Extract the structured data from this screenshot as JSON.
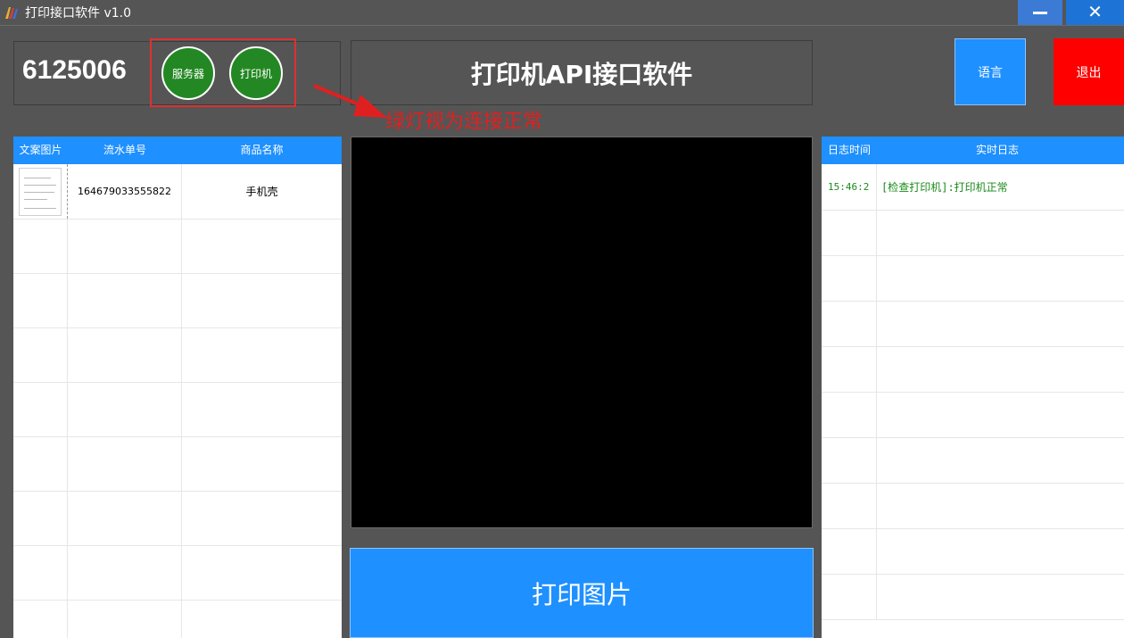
{
  "window": {
    "title": "打印接口软件 v1.0",
    "app_icon": "app-logo-icon",
    "minimize_icon": "minimize-icon",
    "close_icon": "close-icon",
    "close_glyph": "✕"
  },
  "top": {
    "device_id": "6125006",
    "indicators": [
      {
        "label": "服务器",
        "status": "green"
      },
      {
        "label": "打印机",
        "status": "green"
      }
    ],
    "header_title": "打印机API接口软件",
    "lang_button": "语言",
    "exit_button": "退出",
    "annotation": "绿灯视为连接正常"
  },
  "orders": {
    "columns": [
      "文案图片",
      "流水单号",
      "商品名称"
    ],
    "rows": [
      {
        "image": "thumbnail-image",
        "serial": "164679033555822",
        "product": "手机壳"
      }
    ]
  },
  "preview": {
    "print_button": "打印图片"
  },
  "log": {
    "columns": [
      "日志时间",
      "实时日志"
    ],
    "rows": [
      {
        "time": "15:46:2",
        "message": "[检查打印机]:打印机正常"
      }
    ]
  },
  "colors": {
    "background": "#555555",
    "accent_blue": "#1e90ff",
    "exit_red": "#ff0000",
    "indicator_green": "#238823",
    "annotation_red": "#e02020",
    "log_text_green": "#1a8a1a"
  }
}
